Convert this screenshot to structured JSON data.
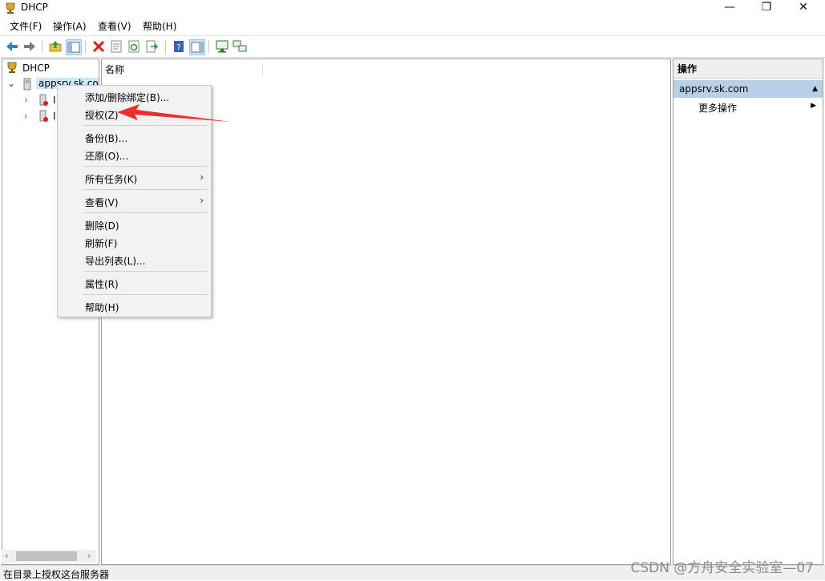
{
  "window": {
    "title": "DHCP",
    "minimize": "—",
    "maximize": "❐",
    "close": "✕"
  },
  "menu": [
    "文件(F)",
    "操作(A)",
    "查看(V)",
    "帮助(H)"
  ],
  "tree": {
    "root": "DHCP",
    "server": "appsrv.sk.co",
    "child1": "I",
    "child2": "I"
  },
  "list": {
    "column_name": "名称"
  },
  "actions": {
    "title": "操作",
    "section": "appsrv.sk.com",
    "more": "更多操作"
  },
  "context_menu": {
    "items": [
      {
        "label": "添加/删除绑定(B)..."
      },
      {
        "label": "授权(Z)"
      },
      {
        "label": "备份(B)..."
      },
      {
        "label": "还原(O)..."
      },
      {
        "label": "所有任务(K)"
      },
      {
        "label": "查看(V)"
      },
      {
        "label": "删除(D)"
      },
      {
        "label": "刷新(F)"
      },
      {
        "label": "导出列表(L)..."
      },
      {
        "label": "属性(R)"
      },
      {
        "label": "帮助(H)"
      }
    ]
  },
  "status": {
    "text": "在目录上授权这台服务器"
  },
  "watermark": "CSDN @方舟安全实验室—07",
  "colors": {
    "selection": "#cce8ff",
    "action_section": "#b8cfe8",
    "annotation_arrow": "#e8302a"
  }
}
